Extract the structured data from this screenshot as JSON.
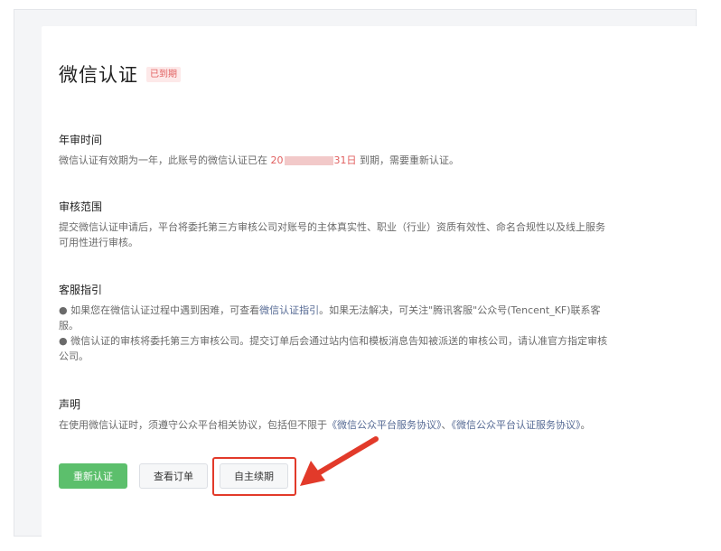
{
  "header": {
    "title": "微信认证",
    "status_badge": "已到期"
  },
  "sections": {
    "annual_review": {
      "title": "年审时间",
      "text_before": "微信认证有效期为一年，此账号的微信认证已在 ",
      "date_prefix": "20",
      "date_suffix": "31日",
      "text_after": " 到期，需要重新认证。"
    },
    "review_scope": {
      "title": "审核范围",
      "text": "提交微信认证申请后，平台将委托第三方审核公司对账号的主体真实性、职业（行业）资质有效性、命名合规性以及线上服务可用性进行审核。"
    },
    "service_guide": {
      "title": "客服指引",
      "bullet1_before": "● 如果您在微信认证过程中遇到困难，可查看",
      "bullet1_link": "微信认证指引",
      "bullet1_after": "。如果无法解决，可关注\"腾讯客服\"公众号(Tencent_KF)联系客服。",
      "bullet2": "● 微信认证的审核将委托第三方审核公司。提交订单后会通过站内信和模板消息告知被派送的审核公司，请认准官方指定审核公司。"
    },
    "statement": {
      "title": "声明",
      "text_before": "在使用微信认证时，须遵守公众平台相关协议，包括但不限于",
      "link1": "《微信公众平台服务协议》",
      "separator": "、",
      "link2": "《微信公众平台认证服务协议》",
      "text_after": "。"
    }
  },
  "actions": {
    "recertify_label": "重新认证",
    "view_orders_label": "查看订单",
    "self_renew_label": "自主续期"
  },
  "colors": {
    "primary_green": "#5cbf6c",
    "alert_red": "#e15f5f",
    "link_blue": "#576b95",
    "annotation_red": "#e23a2a"
  },
  "icons": {
    "annotation": "arrow-pointer-icon"
  }
}
